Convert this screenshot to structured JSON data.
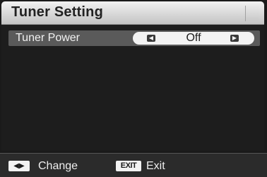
{
  "title": "Tuner Setting",
  "settings": [
    {
      "label": "Tuner Power",
      "value": "Off",
      "left_icon": "arrow-left-icon",
      "right_icon": "arrow-right-icon"
    }
  ],
  "footer": {
    "change": {
      "icon": "left-right-arrows-icon",
      "label": "Change"
    },
    "exit": {
      "key": "EXIT",
      "label": "Exit"
    }
  },
  "colors": {
    "title_bar": "#d8d8d8",
    "background": "#1d1d1d",
    "selected_row": "#5a5a5a",
    "value_pill": "#f3f3f3",
    "footer": "#2b2b2b"
  }
}
